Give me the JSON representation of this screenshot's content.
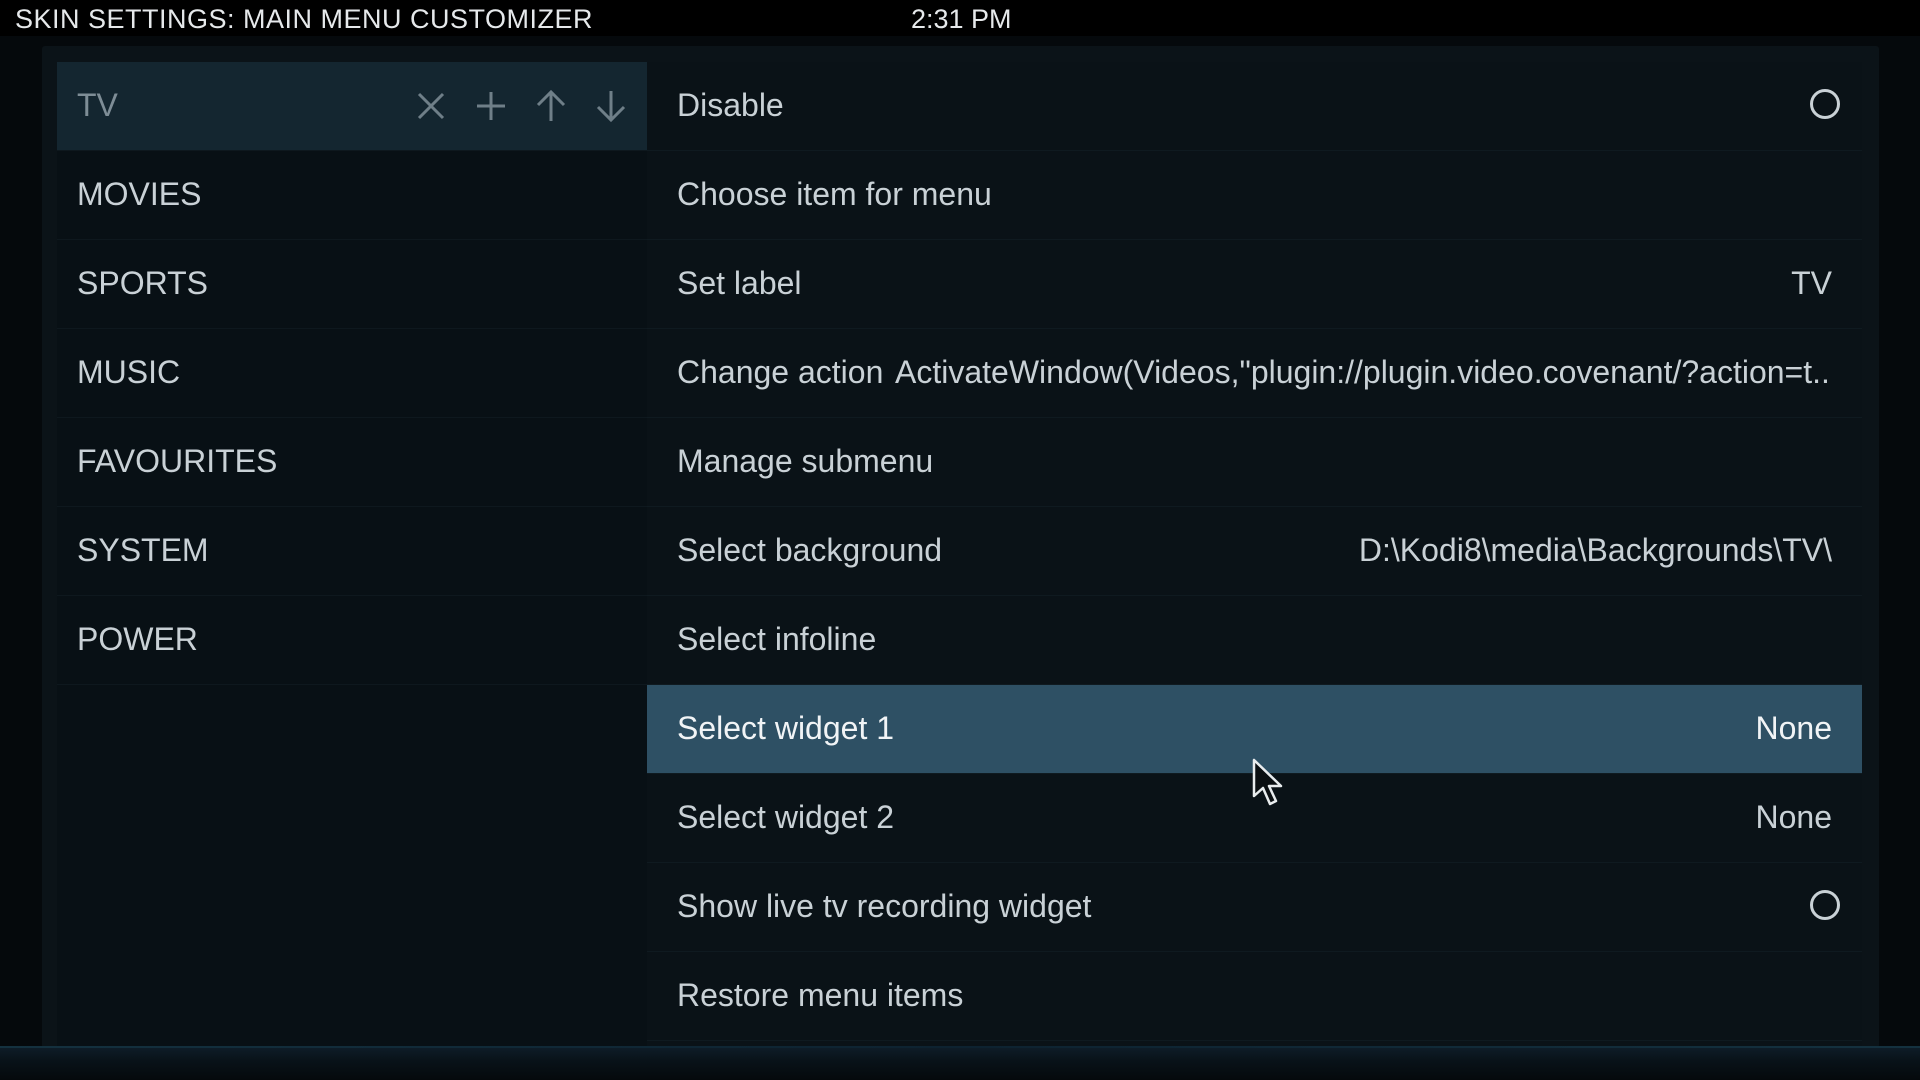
{
  "header": {
    "title": "SKIN SETTINGS: MAIN MENU CUSTOMIZER",
    "clock": "2:31 PM"
  },
  "menu": {
    "items": [
      {
        "label": "TV",
        "selected": true
      },
      {
        "label": "MOVIES"
      },
      {
        "label": "SPORTS"
      },
      {
        "label": "MUSIC"
      },
      {
        "label": "FAVOURITES"
      },
      {
        "label": "SYSTEM"
      },
      {
        "label": "POWER"
      }
    ],
    "tools": [
      "close-icon",
      "add-icon",
      "arrow-up-icon",
      "arrow-down-icon"
    ]
  },
  "options": {
    "items": [
      {
        "label": "Disable",
        "type": "toggle",
        "checked": false
      },
      {
        "label": "Choose item for menu",
        "value": ""
      },
      {
        "label": "Set label",
        "value": "TV"
      },
      {
        "label": "Change action",
        "value": "ActivateWindow(Videos,\"plugin://plugin.video.covenant/?action=t..."
      },
      {
        "label": "Manage submenu",
        "value": ""
      },
      {
        "label": "Select background",
        "value": "D:\\Kodi8\\media\\Backgrounds\\TV\\"
      },
      {
        "label": "Select infoline",
        "value": ""
      },
      {
        "label": "Select widget 1",
        "value": "None",
        "selected": true
      },
      {
        "label": "Select widget 2",
        "value": "None"
      },
      {
        "label": "Show live tv recording widget",
        "type": "toggle",
        "checked": false
      },
      {
        "label": "Restore menu items",
        "value": ""
      }
    ]
  },
  "colors": {
    "background": "#05090c",
    "panel": "#0b1318",
    "selected_row": "#2e5064",
    "selected_menu": "#142630",
    "text": "#c9d1d6"
  }
}
